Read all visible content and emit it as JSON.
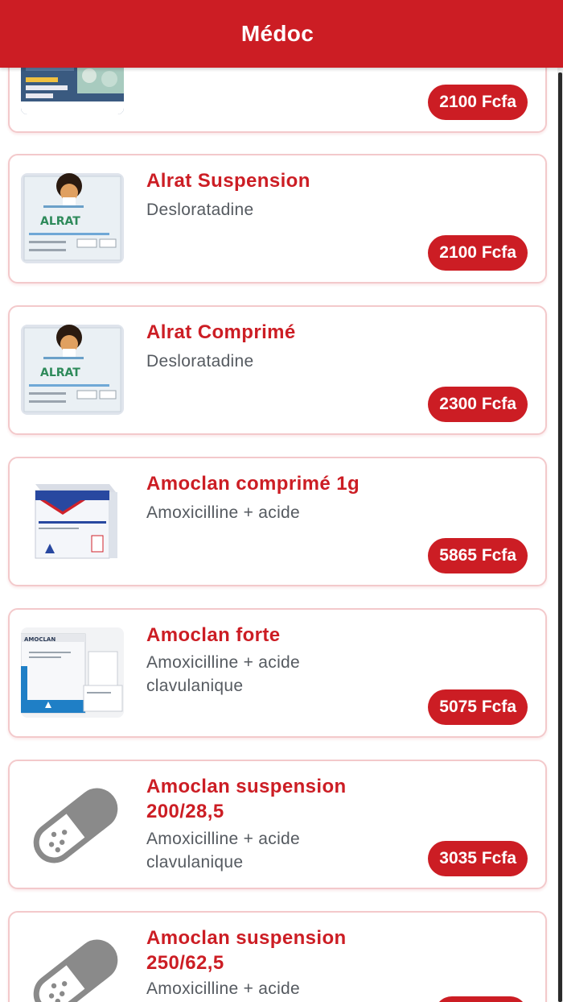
{
  "header": {
    "title": "Médoc"
  },
  "colors": {
    "brand": "#cc1d24",
    "card_border": "#f3c9cb",
    "text_muted": "#555a60"
  },
  "products": [
    {
      "name": "",
      "generic": "",
      "price": "2100 Fcfa",
      "image": "box-photo-icon"
    },
    {
      "name": "Alrat  Suspension",
      "generic": "Desloratadine",
      "price": "2100 Fcfa",
      "image": "alrat-box-icon"
    },
    {
      "name": "Alrat Comprimé",
      "generic": "Desloratadine",
      "price": "2300 Fcfa",
      "image": "alrat-box-icon"
    },
    {
      "name": "Amoclan comprimé 1g",
      "generic": "Amoxicilline + acide",
      "price": "5865 Fcfa",
      "image": "amoclan-box-icon"
    },
    {
      "name": "Amoclan forte",
      "generic": "Amoxicilline + acide clavulanique",
      "price": "5075 Fcfa",
      "image": "amoclan-forte-box-icon"
    },
    {
      "name": "Amoclan suspension 200/28,5",
      "generic": "Amoxicilline + acide clavulanique",
      "price": "3035 Fcfa",
      "image": "pill-capsule-icon"
    },
    {
      "name": "Amoclan suspension 250/62,5",
      "generic": "Amoxicilline + acide",
      "price": "",
      "image": "pill-capsule-icon"
    }
  ]
}
